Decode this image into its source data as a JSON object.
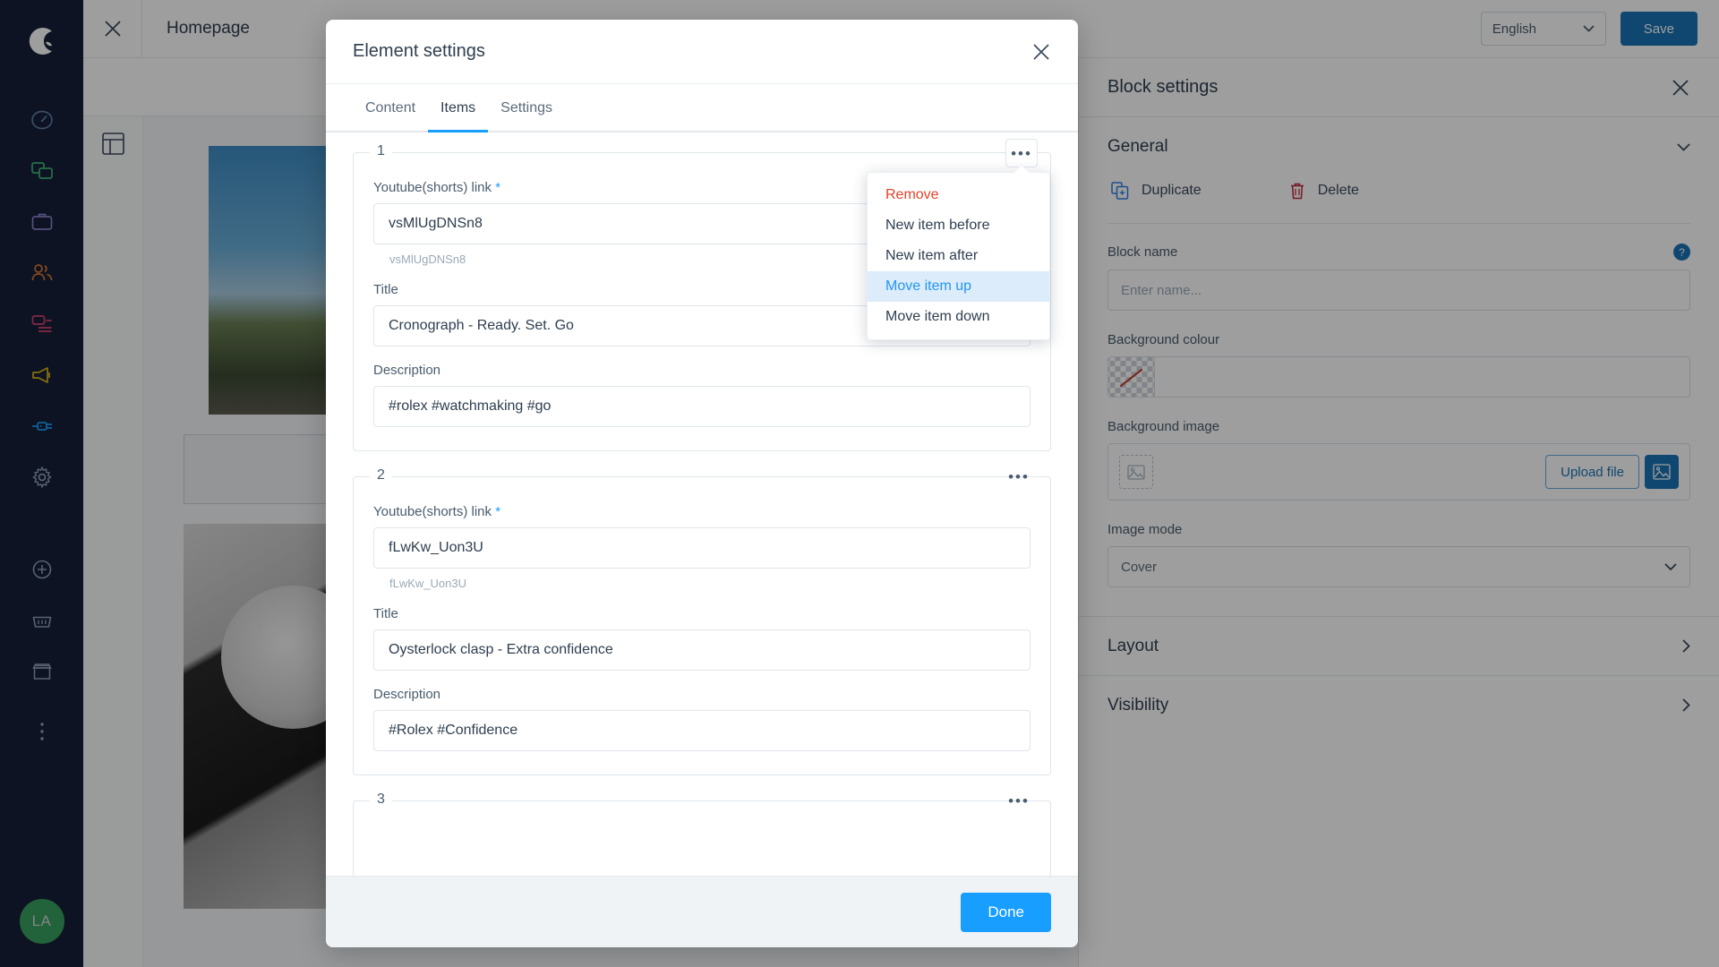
{
  "app": {
    "logo_icon": "shopware-logo-icon",
    "avatar_initials": "LA"
  },
  "sidebar": {
    "items": [
      {
        "icon": "dashboard-gauge-icon",
        "name": "dashboard"
      },
      {
        "icon": "catalogues-copy-icon",
        "name": "catalogues"
      },
      {
        "icon": "orders-briefcase-icon",
        "name": "orders"
      },
      {
        "icon": "customers-people-icon",
        "name": "customers"
      },
      {
        "icon": "content-layers-icon",
        "name": "content"
      },
      {
        "icon": "marketing-megaphone-icon",
        "name": "marketing"
      },
      {
        "icon": "extensions-plug-icon",
        "name": "extensions"
      },
      {
        "icon": "settings-gear-icon",
        "name": "settings"
      }
    ],
    "bottom_items": [
      {
        "icon": "add-circle-icon",
        "name": "quick-add"
      },
      {
        "icon": "basket-icon",
        "name": "basket"
      },
      {
        "icon": "storefront-icon",
        "name": "storefront"
      },
      {
        "icon": "more-vertical-icon",
        "name": "more"
      }
    ]
  },
  "topbar": {
    "close_icon": "close-icon",
    "title": "Homepage",
    "language": "English",
    "language_chevron_icon": "chevron-down-icon",
    "save_label": "Save"
  },
  "device_toolbar": {
    "devices": [
      {
        "icon": "mobile-icon",
        "active": false
      },
      {
        "icon": "tablet-icon",
        "active": false
      },
      {
        "icon": "desktop-icon",
        "active": true
      },
      {
        "icon": "wide-icon",
        "active": false
      }
    ]
  },
  "canvas": {
    "section_icon": "section-layout-icon"
  },
  "modal": {
    "title": "Element settings",
    "close_icon": "close-icon",
    "tabs": [
      {
        "label": "Content",
        "active": false
      },
      {
        "label": "Items",
        "active": true
      },
      {
        "label": "Settings",
        "active": false
      }
    ],
    "items": [
      {
        "number": "1",
        "menu_icon": "ellipsis-icon",
        "link_label": "Youtube(shorts) link",
        "link_required": "*",
        "link_value": "vsMlUgDNSn8",
        "link_hint": "vsMlUgDNSn8",
        "title_label": "Title",
        "title_value": "Cronograph - Ready. Set. Go",
        "description_label": "Description",
        "description_value": "#rolex #watchmaking #go"
      },
      {
        "number": "2",
        "menu_icon": "ellipsis-icon",
        "link_label": "Youtube(shorts) link",
        "link_required": "*",
        "link_value": "fLwKw_Uon3U",
        "link_hint": "fLwKw_Uon3U",
        "title_label": "Title",
        "title_value": "Oysterlock clasp - Extra confidence",
        "description_label": "Description",
        "description_value": "#Rolex #Confidence"
      },
      {
        "number": "3",
        "menu_icon": "ellipsis-icon"
      }
    ],
    "done_label": "Done"
  },
  "context_menu": {
    "items": [
      {
        "label": "Remove",
        "style": "danger"
      },
      {
        "label": "New item before",
        "style": "normal"
      },
      {
        "label": "New item after",
        "style": "normal"
      },
      {
        "label": "Move item up",
        "style": "highlighted"
      },
      {
        "label": "Move item down",
        "style": "normal"
      }
    ]
  },
  "block_settings": {
    "title": "Block settings",
    "close_icon": "close-icon",
    "general_label": "General",
    "general_chevron_icon": "chevron-down-icon",
    "duplicate_label": "Duplicate",
    "duplicate_icon": "duplicate-icon",
    "delete_label": "Delete",
    "delete_icon": "trash-icon",
    "block_name_label": "Block name",
    "block_name_help_icon": "help-icon",
    "block_name_placeholder": "Enter name...",
    "background_colour_label": "Background colour",
    "background_colour_value": "",
    "background_colour_swatch": "no-colour-icon",
    "background_image_label": "Background image",
    "background_image_placeholder_icon": "image-placeholder-icon",
    "upload_file_label": "Upload file",
    "media_button_icon": "media-library-icon",
    "image_mode_label": "Image mode",
    "image_mode_value": "Cover",
    "image_mode_chevron_icon": "chevron-down-icon",
    "layout_label": "Layout",
    "layout_chevron_icon": "chevron-right-icon",
    "visibility_label": "Visibility",
    "visibility_chevron_icon": "chevron-right-icon"
  },
  "colors": {
    "rail_bg": "#151f38",
    "primary_blue": "#189eff",
    "save_blue": "#1a73b5",
    "danger_red": "#e5422b",
    "avatar_green": "#37a05f"
  }
}
